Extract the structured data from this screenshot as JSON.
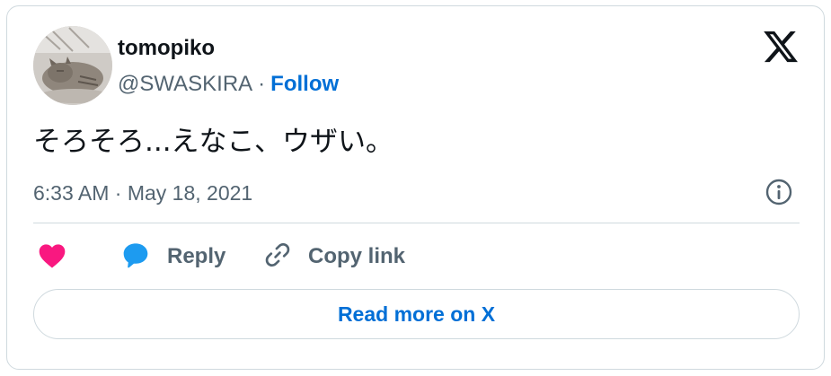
{
  "author": {
    "display_name": "tomopiko",
    "handle": "@SWASKIRA",
    "separator": "·",
    "follow_label": "Follow",
    "avatar_icon": "cat-photo-avatar"
  },
  "brand": {
    "logo_icon": "x-logo-icon"
  },
  "tweet": {
    "text": "そろそろ...えなこ、ウザい。",
    "timestamp": "6:33 AM · May 18, 2021"
  },
  "actions": {
    "like_icon": "heart-icon",
    "reply_label": "Reply",
    "reply_icon": "speech-bubble-icon",
    "copy_label": "Copy link",
    "copy_icon": "link-icon",
    "info_icon": "info-icon"
  },
  "footer": {
    "read_more_label": "Read more on X"
  },
  "colors": {
    "like": "#f91880",
    "reply": "#1d9bf0",
    "link": "#006fd6",
    "muted": "#536471",
    "border": "#cfd9de"
  }
}
